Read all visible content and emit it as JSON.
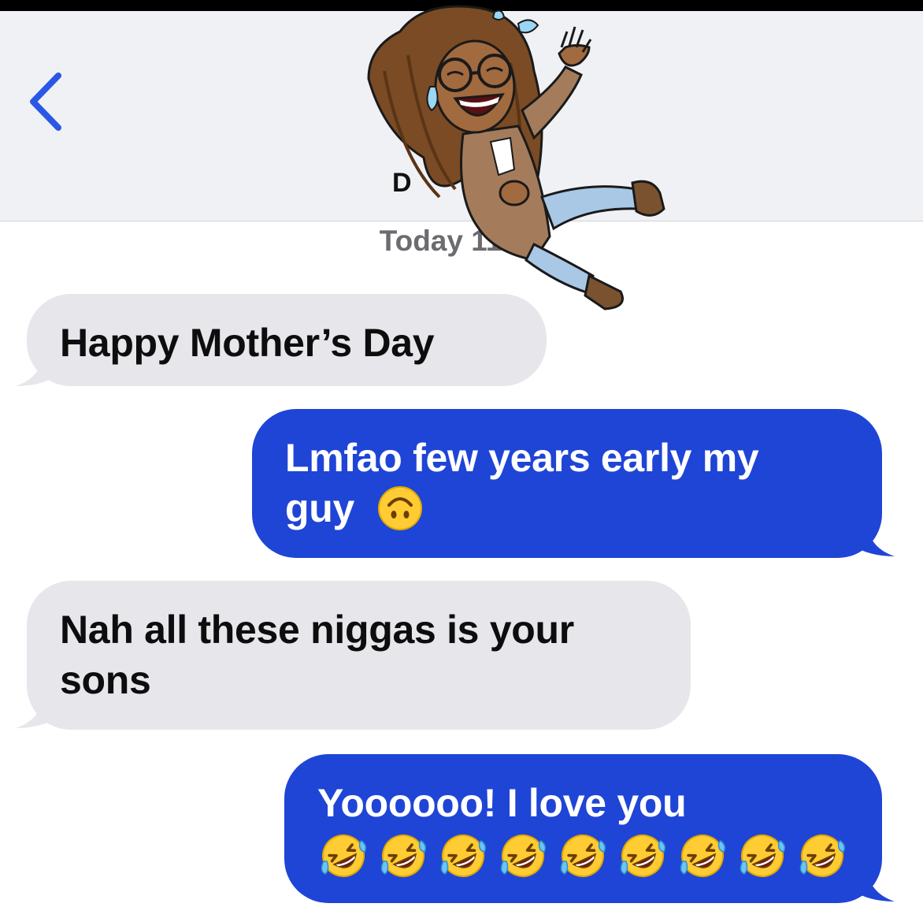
{
  "header": {
    "back_icon": "chevron-left-icon",
    "contact_name": "D",
    "avatar": "bitmoji-laughing-woman",
    "timestamp": "Today 11:0"
  },
  "colors": {
    "accent": "#1f45d6",
    "incoming_bubble": "#e6e6eb",
    "header_bg": "#f0f1f5"
  },
  "messages": [
    {
      "direction": "incoming",
      "text": "Happy Mother’s Day"
    },
    {
      "direction": "outgoing",
      "line1": "Lmfao few years early my",
      "line2": "guy",
      "emoji": "upside-down-face"
    },
    {
      "direction": "incoming",
      "line1": "Nah all these niggas is your",
      "line2": "sons"
    },
    {
      "direction": "outgoing",
      "line1": "Yoooooo! I love you",
      "emoji": "rolling-on-floor-laughing",
      "emoji_count": 9
    }
  ]
}
